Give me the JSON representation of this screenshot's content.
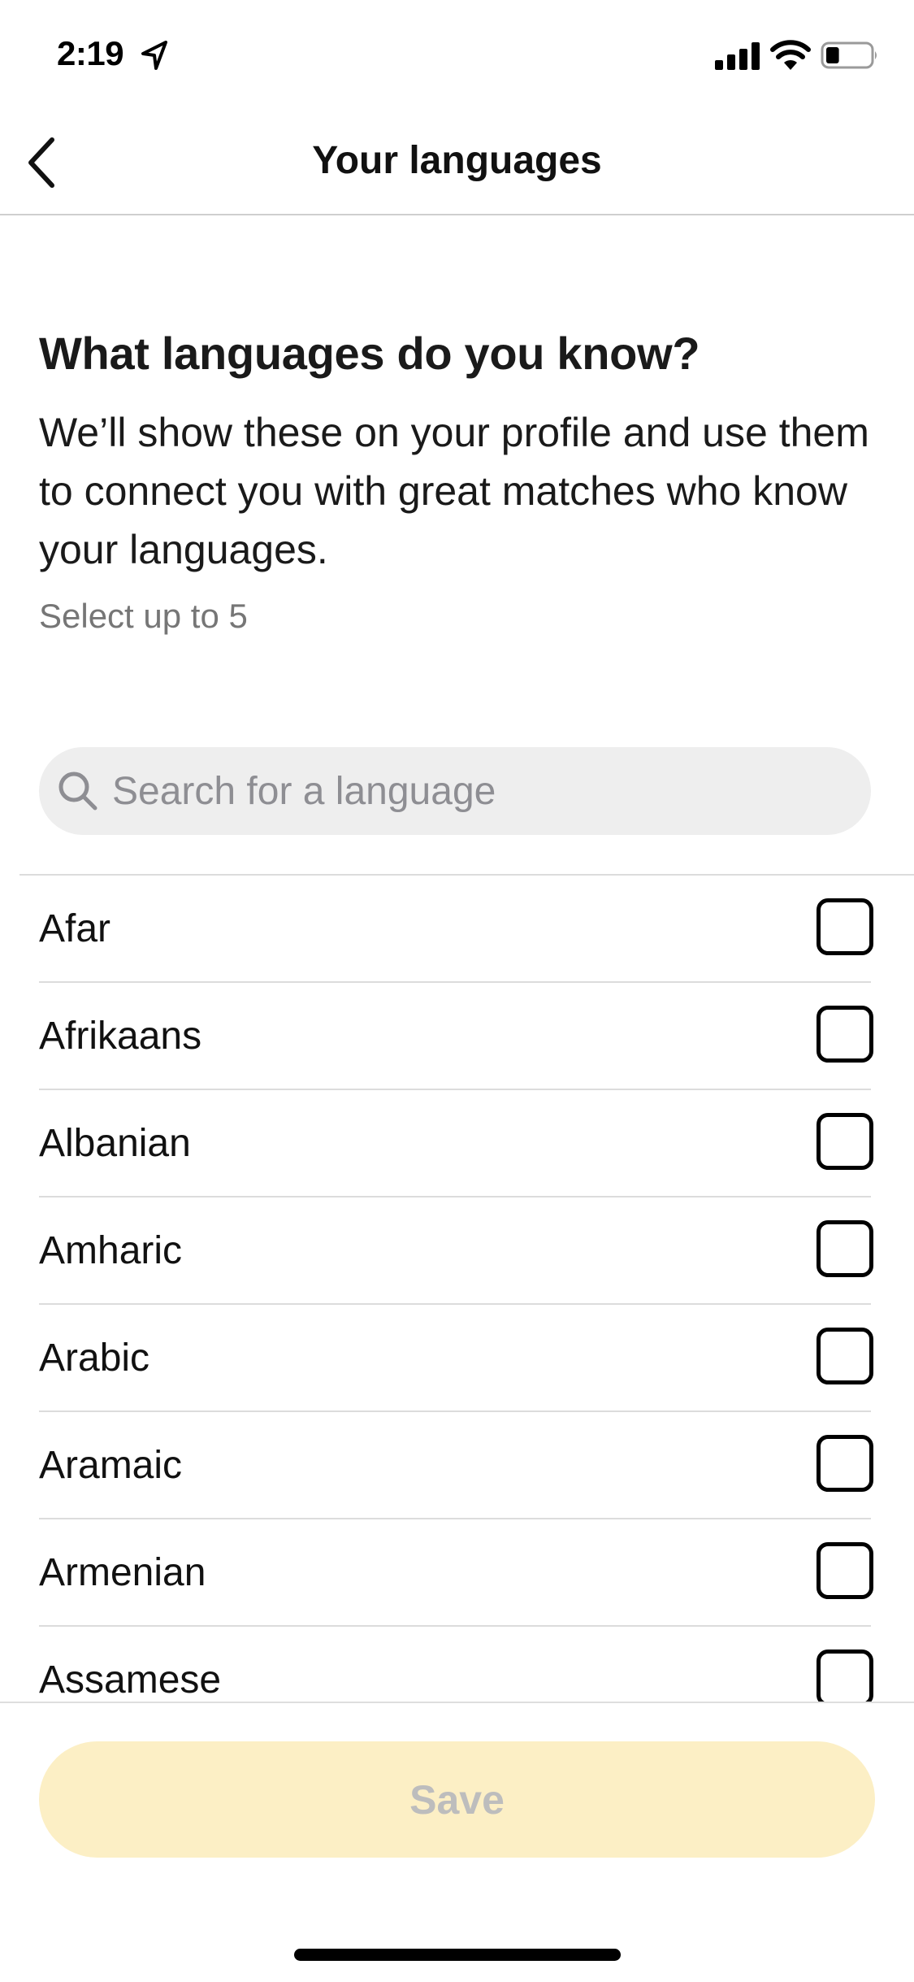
{
  "status_bar": {
    "time": "2:19",
    "icons": [
      "location-arrow-icon",
      "cellular-signal-icon",
      "wifi-icon",
      "battery-icon"
    ],
    "battery_level_percent": 30
  },
  "header": {
    "back_icon": "chevron-left-icon",
    "title": "Your languages"
  },
  "intro": {
    "heading": "What languages do you know?",
    "description": "We’ll show these on your profile and use them to connect you with great matches who know your languages.",
    "hint": "Select up to 5"
  },
  "search": {
    "icon": "search-icon",
    "value": "",
    "placeholder": "Search for a language"
  },
  "languages": [
    {
      "label": "Afar",
      "checked": false
    },
    {
      "label": "Afrikaans",
      "checked": false
    },
    {
      "label": "Albanian",
      "checked": false
    },
    {
      "label": "Amharic",
      "checked": false
    },
    {
      "label": "Arabic",
      "checked": false
    },
    {
      "label": "Aramaic",
      "checked": false
    },
    {
      "label": "Armenian",
      "checked": false
    },
    {
      "label": "Assamese",
      "checked": false
    }
  ],
  "footer": {
    "save_label": "Save",
    "save_enabled": false
  },
  "colors": {
    "save_bg_disabled": "#FCEFC5",
    "save_text_disabled": "#BDBDBD",
    "search_bg": "#EEEEEE",
    "hint_text": "#767676"
  }
}
